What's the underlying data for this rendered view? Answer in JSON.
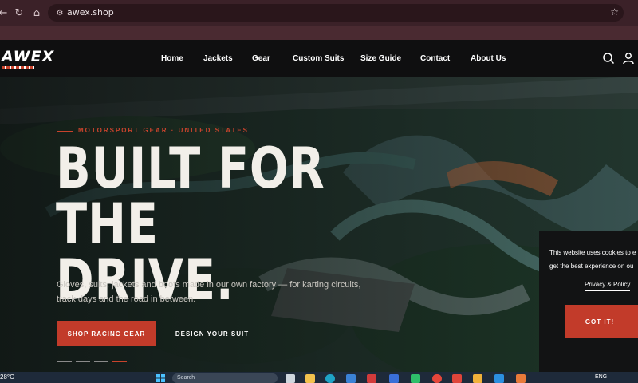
{
  "browser": {
    "url": "awex.shop",
    "back_icon": "arrow-left",
    "reload_icon": "reload",
    "home_icon": "home",
    "site_info_icon": "tune",
    "bookmark_icon": "star"
  },
  "site": {
    "logo_text": "AWEX",
    "nav": [
      "Home",
      "Jackets",
      "Gear",
      "Custom Suits",
      "Size Guide",
      "Contact",
      "About Us"
    ],
    "search_icon": "search",
    "account_icon": "user"
  },
  "hero": {
    "eyebrow": "MOTORSPORT GEAR · UNITED STATES",
    "headline_line1": "BUILT FOR",
    "headline_line2": "THE DRIVE.",
    "subcopy_line1": "Gloves, suits, jackets and boots made in our own factory — for karting circuits,",
    "subcopy_line2": "track days and the road in between.",
    "primary_cta": "SHOP RACING GEAR",
    "secondary_cta": "DESIGN YOUR SUIT",
    "slide_count": 4,
    "active_slide": 4
  },
  "cookie": {
    "line1": "This website uses cookies to e",
    "line2": "get the best experience on ou",
    "policy_link": "Privacy & Policy",
    "button": "GOT IT!"
  },
  "taskbar": {
    "weather": "28°C",
    "search_placeholder": "Search",
    "lang": "ENG"
  },
  "colors": {
    "accent": "#c23b2a",
    "browser_bar": "#3b2128",
    "header_bg": "#0f0f10"
  }
}
